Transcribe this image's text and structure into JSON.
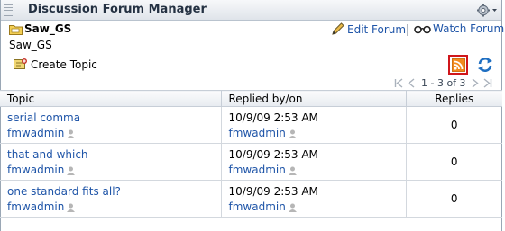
{
  "window": {
    "title": "Discussion Forum Manager"
  },
  "forum": {
    "name": "Saw_GS",
    "subtitle": "Saw_GS"
  },
  "actions": {
    "edit_forum": "Edit Forum",
    "watch_forum": "Watch Forum",
    "create_topic": "Create Topic"
  },
  "pager": {
    "range": "1 - 3 of 3"
  },
  "table": {
    "headers": {
      "topic": "Topic",
      "replied": "Replied by/on",
      "replies": "Replies"
    },
    "rows": [
      {
        "topic": "serial comma",
        "topic_author": "fmwadmin",
        "replied_on": "10/9/09 2:53 AM",
        "replied_by": "fmwadmin",
        "replies": "0"
      },
      {
        "topic": "that and which",
        "topic_author": "fmwadmin",
        "replied_on": "10/9/09 2:53 AM",
        "replied_by": "fmwadmin",
        "replies": "0"
      },
      {
        "topic": "one standard fits all?",
        "topic_author": "fmwadmin",
        "replied_on": "10/9/09 2:53 AM",
        "replied_by": "fmwadmin",
        "replies": "0"
      }
    ]
  },
  "colors": {
    "link": "#1f55a8",
    "rss_highlight": "#d0161b",
    "rss_orange": "#f28a1d"
  }
}
